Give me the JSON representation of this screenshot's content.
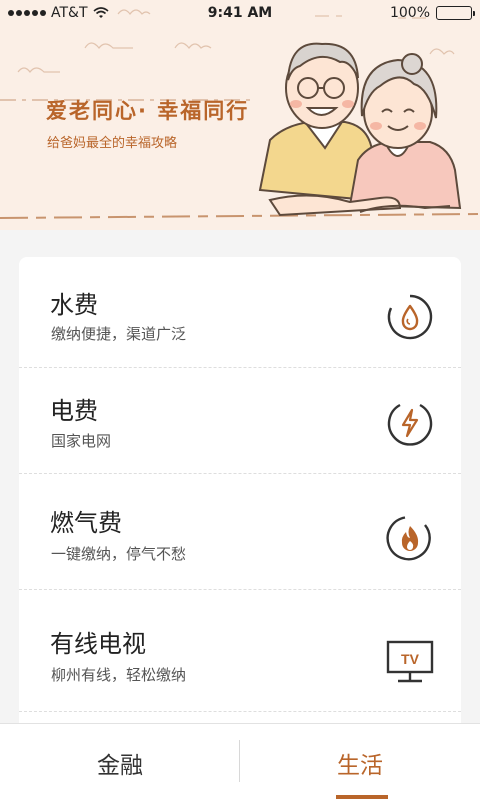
{
  "status_bar": {
    "carrier": "AT&T",
    "time": "9:41 AM",
    "battery": "100%"
  },
  "banner": {
    "title": "爱老同心· 幸福同行",
    "subtitle": "给爸妈最全的幸福攻略"
  },
  "services": [
    {
      "title": "水费",
      "subtitle": "缴纳便捷，渠道广泛",
      "icon": "water-drop-icon"
    },
    {
      "title": "电费",
      "subtitle": "国家电网",
      "icon": "lightning-icon"
    },
    {
      "title": "燃气费",
      "subtitle": "一键缴纳，停气不愁",
      "icon": "flame-icon"
    },
    {
      "title": "有线电视",
      "subtitle": "柳州有线，轻松缴纳",
      "icon": "tv-icon",
      "icon_text": "TV"
    }
  ],
  "tabs": [
    {
      "label": "金融",
      "active": false
    },
    {
      "label": "生活",
      "active": true
    }
  ],
  "colors": {
    "accent": "#b9652a",
    "banner_bg": "#fbefe6",
    "page_bg": "#f4f4f4"
  }
}
